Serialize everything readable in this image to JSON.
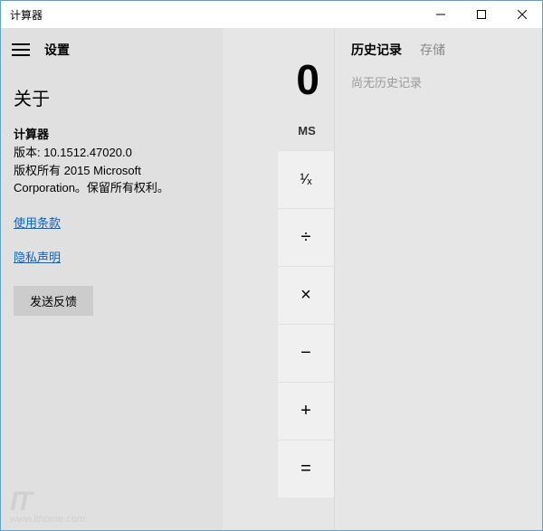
{
  "titlebar": {
    "title": "计算器"
  },
  "settings": {
    "header": "设置",
    "about": {
      "heading": "关于",
      "app_name": "计算器",
      "version_line": "版本: 10.1512.47020.0",
      "copyright_line1": "版权所有 2015 Microsoft",
      "copyright_line2": "Corporation。保留所有权利。",
      "terms_link": "使用条款",
      "privacy_link": "隐私声明",
      "feedback_button": "发送反馈"
    }
  },
  "calculator": {
    "display_value": "0",
    "memory_label": "MS",
    "ops": {
      "reciprocal": "¹⁄ₓ",
      "divide": "÷",
      "multiply": "×",
      "minus": "−",
      "plus": "+",
      "equals": "="
    }
  },
  "history": {
    "tab_history": "历史记录",
    "tab_memory": "存储",
    "empty_text": "尚无历史记录"
  },
  "watermark": {
    "logo": "IT",
    "url": "www.ithome.com"
  }
}
